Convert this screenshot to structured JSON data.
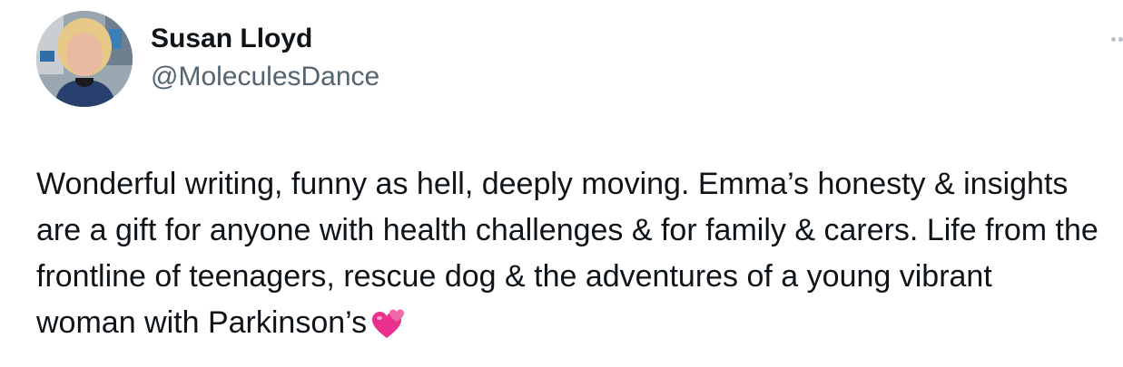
{
  "tweet": {
    "author": {
      "display_name": "Susan Lloyd",
      "handle": "@MoleculesDance",
      "avatar_icon": "profile-photo"
    },
    "more_icon": "more-horizontal-icon",
    "text": "Wonderful writing, funny as hell, deeply moving. Emma’s honesty & insights are a gift for anyone with health challenges & for family & carers. Life from the frontline of teenagers, rescue dog & the adventures of a young vibrant woman with Parkinson’s",
    "emoji": "two-hearts-emoji"
  },
  "colors": {
    "text_primary": "#0f1419",
    "text_secondary": "#536471",
    "emoji_pink": "#e8308c"
  }
}
